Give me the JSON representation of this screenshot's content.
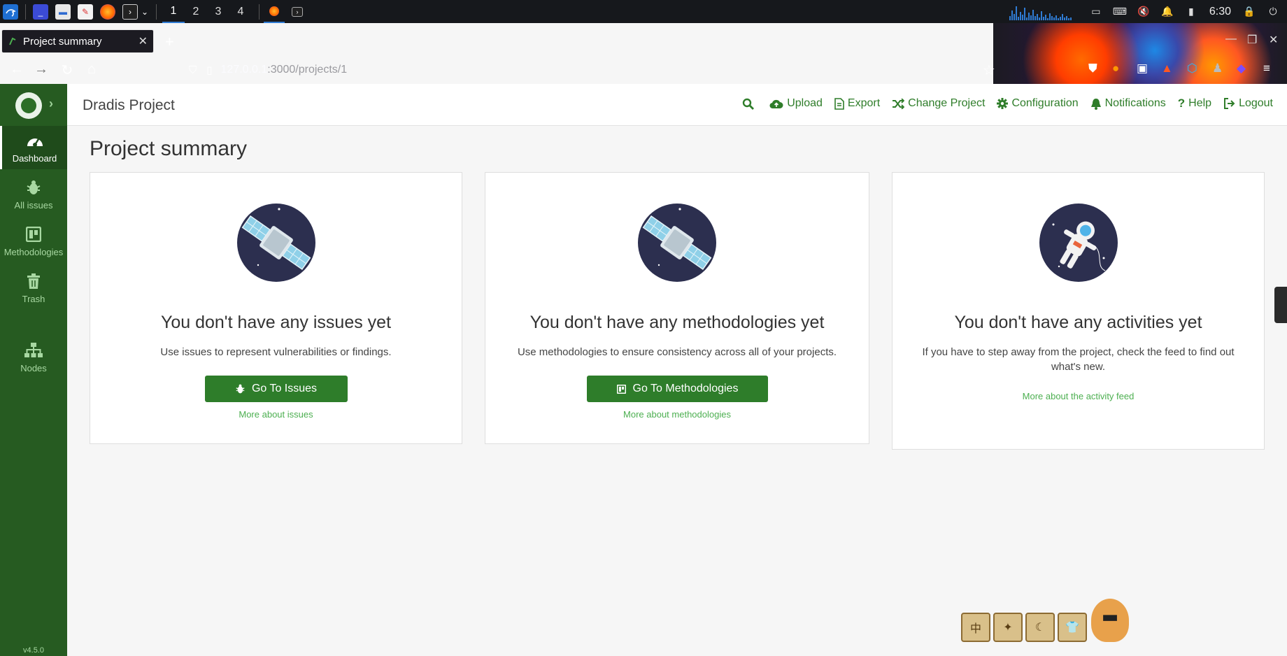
{
  "taskbar": {
    "workspaces": [
      "1",
      "2",
      "3",
      "4"
    ],
    "active_workspace": "1",
    "clock": "6:30"
  },
  "browser": {
    "tab_title": "Project summary",
    "url_host": "127.0.0.1",
    "url_path": ":3000/projects/1"
  },
  "sidebar": {
    "items": [
      {
        "label": "Dashboard",
        "icon": "dashboard-icon",
        "active": true
      },
      {
        "label": "All issues",
        "icon": "bug-icon"
      },
      {
        "label": "Methodologies",
        "icon": "board-icon"
      },
      {
        "label": "Trash",
        "icon": "trash-icon"
      },
      {
        "label": "Nodes",
        "icon": "sitemap-icon"
      }
    ],
    "version": "v4.5.0"
  },
  "header": {
    "brand": "Dradis Project",
    "nav": [
      {
        "label": "Upload",
        "icon": "cloud-upload-icon"
      },
      {
        "label": "Export",
        "icon": "file-icon"
      },
      {
        "label": "Change Project",
        "icon": "shuffle-icon"
      },
      {
        "label": "Configuration",
        "icon": "gear-icon"
      },
      {
        "label": "Notifications",
        "icon": "bell-icon"
      },
      {
        "label": "Help",
        "icon": "question-icon"
      },
      {
        "label": "Logout",
        "icon": "logout-icon"
      }
    ]
  },
  "main": {
    "title": "Project summary",
    "cards": [
      {
        "title": "You don't have any issues yet",
        "description": "Use issues to represent vulnerabilities or findings.",
        "button": "Go To Issues",
        "link": "More about issues"
      },
      {
        "title": "You don't have any methodologies yet",
        "description": "Use methodologies to ensure consistency across all of your projects.",
        "button": "Go To Methodologies",
        "link": "More about methodologies"
      },
      {
        "title": "You don't have any activities yet",
        "description": "If you have to step away from the project, check the feed to find out what's new.",
        "link": "More about the activity feed"
      }
    ]
  },
  "colors": {
    "sidebar": "#265b21",
    "accent": "#2e7d2a",
    "link": "#4caf50"
  }
}
